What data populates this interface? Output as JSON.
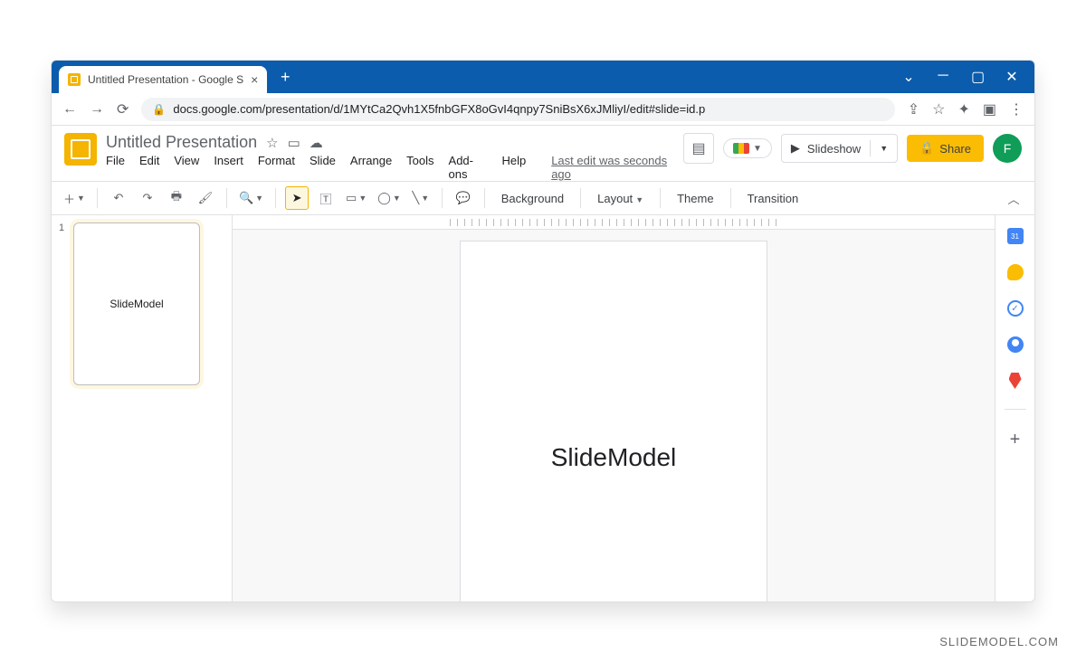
{
  "browser": {
    "tab_title": "Untitled Presentation - Google S",
    "url": "docs.google.com/presentation/d/1MYtCa2Qvh1X5fnbGFX8oGvI4qnpy7SniBsX6xJMliyI/edit#slide=id.p"
  },
  "doc": {
    "title": "Untitled Presentation",
    "last_edit": "Last edit was seconds ago",
    "avatar_initial": "F"
  },
  "menus": {
    "file": "File",
    "edit": "Edit",
    "view": "View",
    "insert": "Insert",
    "format": "Format",
    "slide": "Slide",
    "arrange": "Arrange",
    "tools": "Tools",
    "addons": "Add-ons",
    "help": "Help"
  },
  "header_buttons": {
    "slideshow": "Slideshow",
    "share": "Share"
  },
  "toolbar": {
    "background": "Background",
    "layout": "Layout",
    "theme": "Theme",
    "transition": "Transition"
  },
  "thumbs": {
    "slide1_num": "1",
    "slide1_text": "SlideModel"
  },
  "canvas": {
    "slide_text": "SlideModel"
  },
  "watermark": "SLIDEMODEL.COM"
}
